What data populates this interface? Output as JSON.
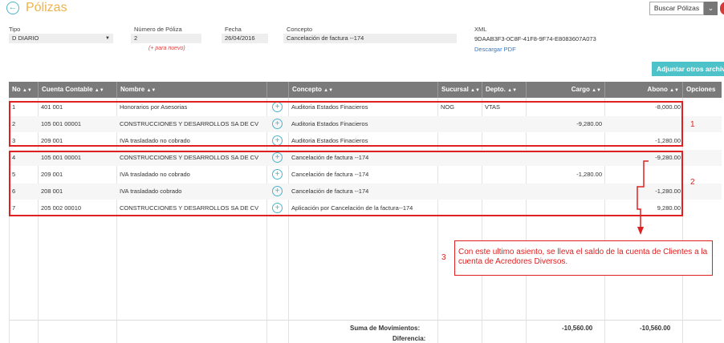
{
  "header": {
    "title": "Pólizas",
    "search_button": "Buscar Pólizas"
  },
  "form": {
    "tipo_label": "Tipo",
    "tipo_value": "D DIARIO",
    "numero_label": "Número de Póliza",
    "numero_value": "2",
    "numero_hint": "(+ para nuevo)",
    "fecha_label": "Fecha",
    "fecha_value": "26/04/2016",
    "concepto_label": "Concepto",
    "concepto_value": "Cancelación de factura --174",
    "xml_label": "XML",
    "xml_value": "9DAAB3F3-0C8F-41F8-9F74-E8083607A073",
    "download_link": "Descargar PDF",
    "attach_button": "Adjuntar otros archivos"
  },
  "table": {
    "columns": [
      "No",
      "Cuenta Contable",
      "Nombre",
      "",
      "Concepto",
      "Sucursal",
      "Depto.",
      "Cargo",
      "Abono",
      "Opciones"
    ],
    "rows": [
      {
        "no": "1",
        "cuenta": "401 001",
        "nombre": "Honorarios por Asesorias",
        "concepto": "Auditoria Estados Finacieros",
        "sucursal": "NOG",
        "depto": "VTAS",
        "cargo": "",
        "abono": "-8,000.00"
      },
      {
        "no": "2",
        "cuenta": "105 001 00001",
        "nombre": "CONSTRUCCIONES Y DESARROLLOS SA DE CV",
        "concepto": "Auditoria Estados Finacieros",
        "sucursal": "",
        "depto": "",
        "cargo": "-9,280.00",
        "abono": ""
      },
      {
        "no": "3",
        "cuenta": "209 001",
        "nombre": "IVA trasladado no cobrado",
        "concepto": "Auditoria Estados Finacieros",
        "sucursal": "",
        "depto": "",
        "cargo": "",
        "abono": "-1,280.00"
      },
      {
        "no": "4",
        "cuenta": "105 001 00001",
        "nombre": "CONSTRUCCIONES Y DESARROLLOS SA DE CV",
        "concepto": "Cancelación de factura --174",
        "sucursal": "",
        "depto": "",
        "cargo": "",
        "abono": "-9,280.00"
      },
      {
        "no": "5",
        "cuenta": "209 001",
        "nombre": "IVA trasladado no cobrado",
        "concepto": "Cancelación de factura --174",
        "sucursal": "",
        "depto": "",
        "cargo": "-1,280.00",
        "abono": ""
      },
      {
        "no": "6",
        "cuenta": "208 001",
        "nombre": "IVA trasladado cobrado",
        "concepto": "Cancelación de factura --174",
        "sucursal": "",
        "depto": "",
        "cargo": "",
        "abono": "-1,280.00"
      },
      {
        "no": "7",
        "cuenta": "205 002 00010",
        "nombre": "CONSTRUCCIONES Y DESARROLLOS SA DE CV",
        "concepto": "Aplicación por Cancelación de la factura--174",
        "sucursal": "",
        "depto": "",
        "cargo": "",
        "abono": "9,280.00"
      }
    ],
    "footer": {
      "sum_label": "Suma de Movimientos:",
      "diff_label": "Diferencia:",
      "cargo_total": "-10,560.00",
      "abono_total": "-10,560.00"
    }
  },
  "annotations": {
    "n1": "1",
    "n2": "2",
    "n3": "3",
    "note": "Con este ultimo asiento, se lleva el saldo de la cuenta de Clientes a  la cuenta de Acredores Diversos.",
    "color": "#e02020"
  }
}
